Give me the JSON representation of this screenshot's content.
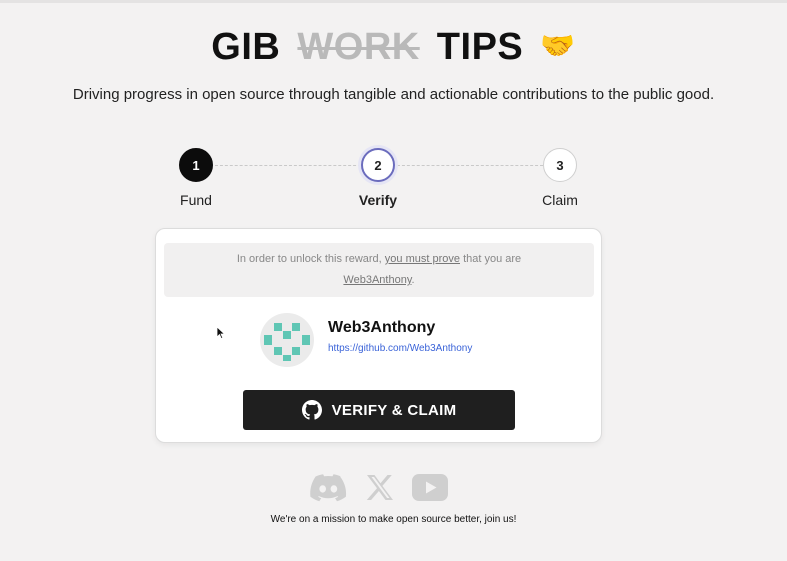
{
  "header": {
    "title_part1": "GIB",
    "title_strike": "WORK",
    "title_part2": "TIPS",
    "title_emoji": "🤝",
    "subtitle": "Driving progress in open source through tangible and actionable contributions to the public good."
  },
  "stepper": {
    "steps": [
      {
        "number": "1",
        "label": "Fund",
        "state": "done"
      },
      {
        "number": "2",
        "label": "Verify",
        "state": "active"
      },
      {
        "number": "3",
        "label": "Claim",
        "state": "pending"
      }
    ]
  },
  "card": {
    "notice": {
      "text_before": "In order to unlock this reward,",
      "link_text": "you must prove",
      "text_after": "that you are",
      "username_link": "Web3Anthony",
      "period": "."
    },
    "profile": {
      "username": "Web3Anthony",
      "url": "https://github.com/Web3Anthony"
    },
    "verify_button_label": "VERIFY & CLAIM"
  },
  "footer": {
    "social_icons": [
      "discord-icon",
      "x-icon",
      "youtube-icon"
    ],
    "mission_text": "We're on a mission to make open source better, join us!"
  },
  "colors": {
    "background": "#f3f2f2",
    "button": "#1f1f1f",
    "link": "#3a63d8",
    "avatar_accent": "#5fc6b4",
    "active_step_ring": "#6b6cbd"
  }
}
